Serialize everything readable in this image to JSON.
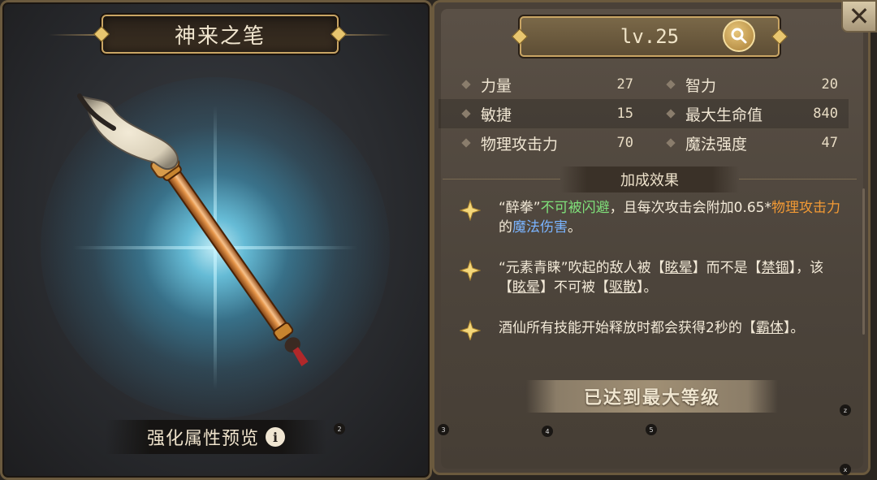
{
  "item": {
    "name": "神来之笔",
    "enhance_preview_label": "强化属性预览",
    "info_glyph": "i"
  },
  "header": {
    "level": "lv.25",
    "search_icon": "search-icon",
    "close_glyph": "✕"
  },
  "stats": [
    {
      "left_label": "力量",
      "left_value": "27",
      "right_label": "智力",
      "right_value": "20"
    },
    {
      "left_label": "敏捷",
      "left_value": "15",
      "right_label": "最大生命值",
      "right_value": "840"
    },
    {
      "left_label": "物理攻击力",
      "left_value": "70",
      "right_label": "魔法强度",
      "right_value": "47"
    }
  ],
  "bonus": {
    "header": "加成效果",
    "effects": [
      {
        "parts": [
          {
            "t": "“醉拳”",
            "c": ""
          },
          {
            "t": "不可被闪避",
            "c": "hl-green"
          },
          {
            "t": "，且每次攻击会附加0.65*",
            "c": ""
          },
          {
            "t": "物理攻击力",
            "c": "hl-orange"
          },
          {
            "t": "的",
            "c": ""
          },
          {
            "t": "魔法伤害",
            "c": "hl-blue"
          },
          {
            "t": "。",
            "c": ""
          }
        ]
      },
      {
        "parts": [
          {
            "t": "“元素青睐”吹起的敌人被【",
            "c": ""
          },
          {
            "t": "眩晕",
            "c": "hl-u"
          },
          {
            "t": "】而不是【",
            "c": ""
          },
          {
            "t": "禁锢",
            "c": "hl-u"
          },
          {
            "t": "】，该【",
            "c": ""
          },
          {
            "t": "眩晕",
            "c": "hl-u"
          },
          {
            "t": "】不可被【",
            "c": ""
          },
          {
            "t": "驱散",
            "c": "hl-u"
          },
          {
            "t": "】。",
            "c": ""
          }
        ]
      },
      {
        "parts": [
          {
            "t": "酒仙所有技能开始释放时都会获得2秒的【",
            "c": ""
          },
          {
            "t": "霸体",
            "c": "hl-u"
          },
          {
            "t": "】。",
            "c": ""
          }
        ]
      }
    ]
  },
  "max_level_label": "已达到最大等级",
  "badges": [
    "2",
    "3",
    "4",
    "5",
    "z",
    "x"
  ],
  "colors": {
    "gold": "#c9a564",
    "green": "#7fe07a",
    "orange": "#f39a34",
    "blue": "#7ab4ff"
  }
}
